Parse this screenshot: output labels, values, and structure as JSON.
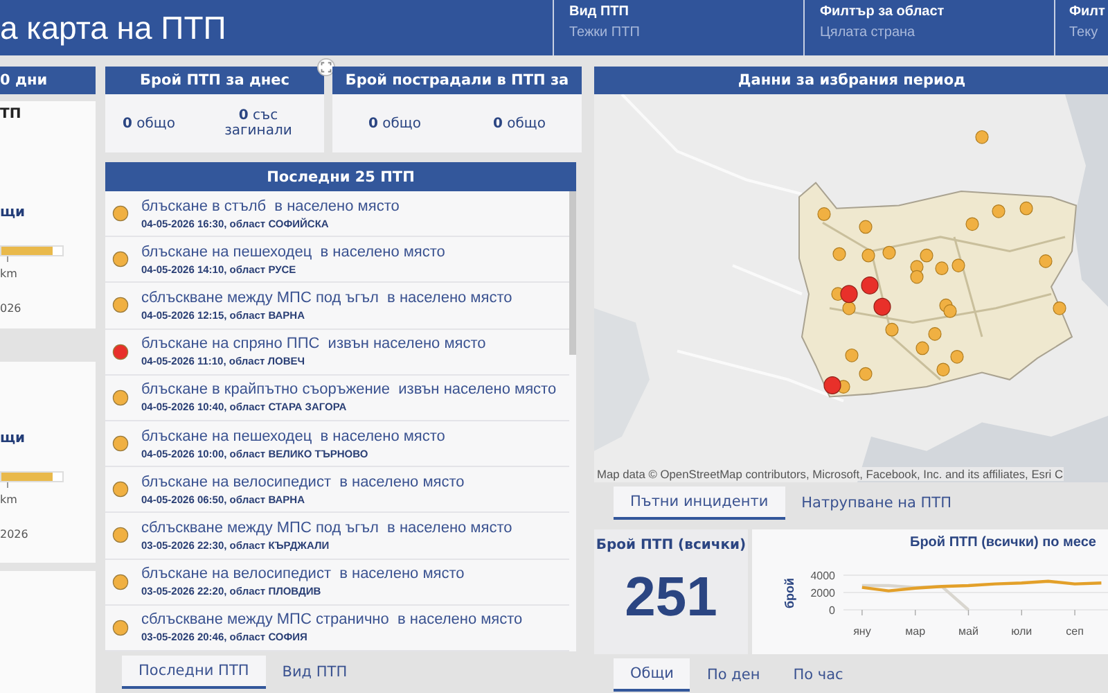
{
  "header": {
    "title": "а карта на ПТП",
    "filters": [
      {
        "label": "Вид ПТП",
        "value": "Тежки ПТП"
      },
      {
        "label": "Филтър за област",
        "value": "Цялата страна"
      },
      {
        "label": "Филт",
        "value": "Теку"
      }
    ]
  },
  "left_cards": [
    {
      "header": "0 дни",
      "title": "ТП",
      "label": "щи",
      "level": 0.83,
      "unit": "km",
      "date": "026"
    },
    {
      "label": "щи",
      "level": 0.83,
      "unit": "km",
      "date": "2026"
    }
  ],
  "today_cards": [
    {
      "header": "Брой ПТП за днес",
      "stats": [
        "**0** общо",
        "**0** със загинали"
      ]
    },
    {
      "header": "Брой пострадали в ПТП за",
      "stats": [
        "**0** общо",
        "**0** общо"
      ]
    }
  ],
  "recent": {
    "title": "Последни 25 ПТП",
    "items": [
      {
        "title": "блъскане в стълб  в населено място",
        "details": "04-05-2026 16:30, област СОФИЙСКА",
        "color": "#f0b042"
      },
      {
        "title": "блъскане на пешеходец  в населено място",
        "details": "04-05-2026 14:10, област РУСЕ",
        "color": "#f0b042"
      },
      {
        "title": "сблъскване между МПС под ъгъл  в населено място",
        "details": "04-05-2026 12:15, област ВАРНА",
        "color": "#f0b042"
      },
      {
        "title": "блъскане на спряно ППС  извън населено място",
        "details": "04-05-2026 11:10, област ЛОВЕЧ",
        "color": "#e8302a"
      },
      {
        "title": "блъскане в крайпътно съоръжение  извън населено място",
        "details": "04-05-2026 10:40, област СТАРА ЗАГОРА",
        "color": "#f0b042"
      },
      {
        "title": "блъскане на пешеходец  в населено място",
        "details": "04-05-2026 10:00, област ВЕЛИКО ТЪРНОВО",
        "color": "#f0b042"
      },
      {
        "title": "блъскане на велосипедист  в населено място",
        "details": "04-05-2026 06:50, област ВАРНА",
        "color": "#f0b042"
      },
      {
        "title": "сблъскване между МПС под ъгъл  в населено място",
        "details": "03-05-2026 22:30, област КЪРДЖАЛИ",
        "color": "#f0b042"
      },
      {
        "title": "блъскане на велосипедист  в населено място",
        "details": "03-05-2026 22:20, област ПЛОВДИВ",
        "color": "#f0b042"
      },
      {
        "title": "сблъскване между МПС странично  в населено място",
        "details": "03-05-2026 20:46, област СОФИЯ",
        "color": "#f0b042"
      }
    ]
  },
  "left_tabs": [
    {
      "label": "Последни ПТП",
      "selected": true
    },
    {
      "label": "Вид ПТП",
      "selected": false
    }
  ],
  "period": {
    "title": "Данни за избрания период",
    "map": {
      "kind": "picture",
      "attribution": "Map data © OpenStreetMap contributors, Microsoft, Facebook, Inc. and its affiliates, Esri C"
    }
  },
  "map_tabs": [
    {
      "label": "Пътни инциденти",
      "selected": true
    },
    {
      "label": "Натрупване на ПТП",
      "selected": false
    }
  ],
  "kpi": {
    "label": "Брой ПТП (всички)",
    "value": "251"
  },
  "monthly": {
    "title": "Брой ПТП (всички) по месе",
    "chart_data": {
      "type": "line",
      "ylabel": "брой",
      "categories": [
        "яну",
        null,
        "мар",
        null,
        "май",
        null,
        "юли",
        null,
        "сеп",
        null
      ],
      "ylim": [
        0,
        4000
      ],
      "yticks": [
        0,
        2000,
        4000
      ],
      "series": [
        {
          "color": "#d9d6cf",
          "values": [
            2800,
            2800,
            2600,
            2700,
            0,
            null,
            null,
            null,
            null,
            null
          ]
        },
        {
          "color": "#e3a02a",
          "values": [
            2600,
            2200,
            2500,
            2700,
            2800,
            3000,
            3100,
            3300,
            3000,
            3100
          ]
        }
      ]
    }
  },
  "bottom_tabs": [
    {
      "label": "Общи",
      "selected": true
    },
    {
      "label": "По ден",
      "selected": false
    },
    {
      "label": "По час",
      "selected": false
    }
  ]
}
